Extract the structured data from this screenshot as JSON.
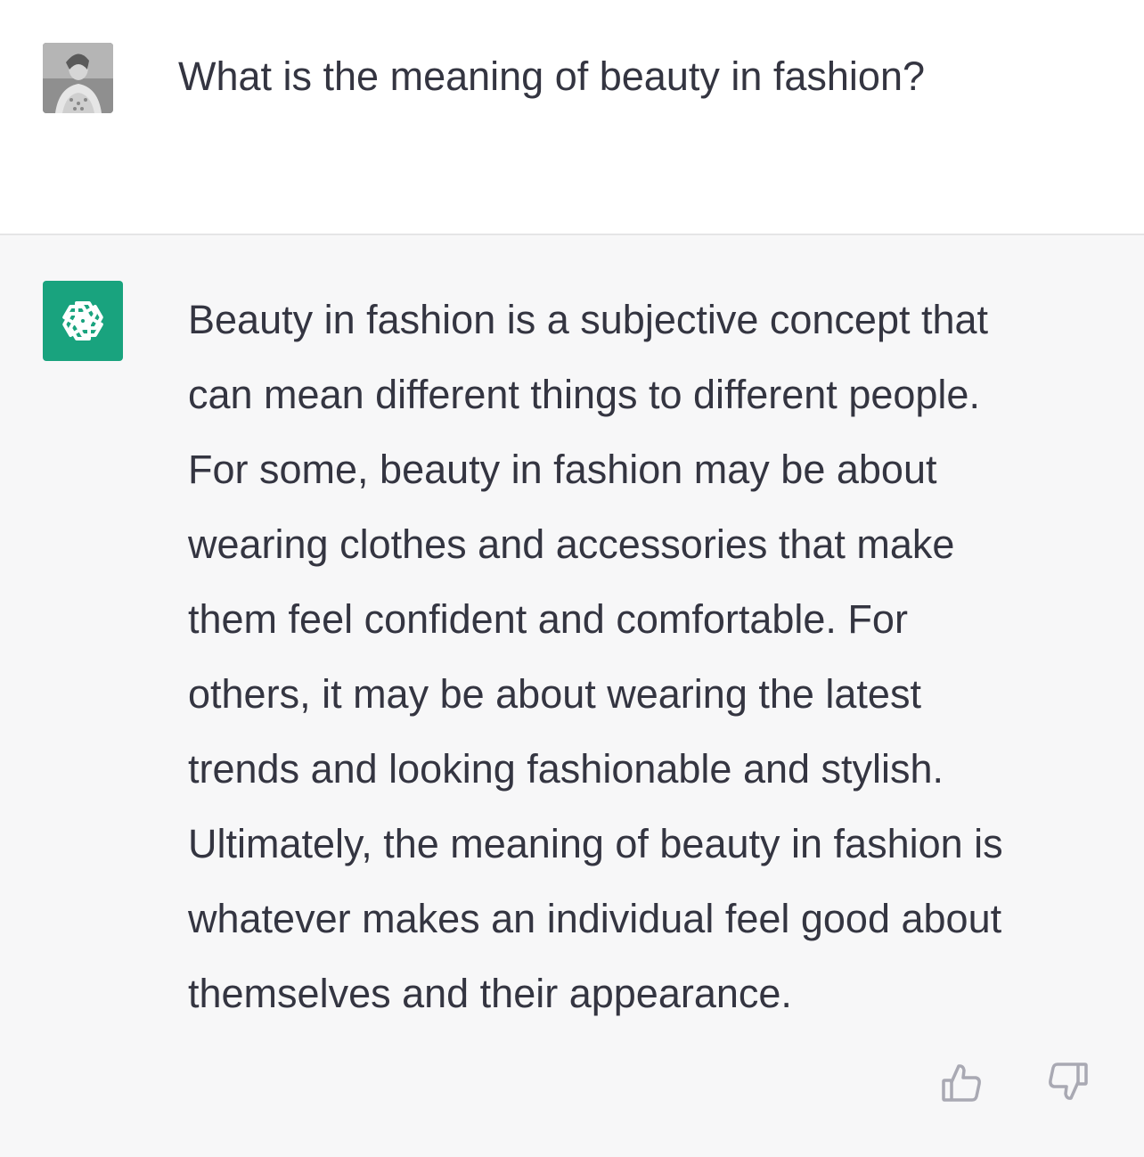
{
  "user_message": {
    "text": "What is the meaning of beauty in fashion?"
  },
  "assistant_message": {
    "lines": [
      "Beauty in fashion is a subjective concept that",
      "can mean different things to different people.",
      "For some, beauty in fashion may be about",
      "wearing clothes and accessories that make",
      "them feel confident and comfortable. For",
      "others, it may be about wearing the latest",
      "trends and looking fashionable and stylish.",
      "Ultimately, the meaning of beauty in fashion is",
      "whatever makes an individual feel good about",
      "themselves and their appearance."
    ]
  },
  "icons": {
    "user_avatar": "user-avatar-photo",
    "assistant_avatar": "openai-logo-icon",
    "thumbs_up": "thumbs-up-icon",
    "thumbs_down": "thumbs-down-icon"
  },
  "colors": {
    "assistant_avatar_bg": "#19a37e",
    "assistant_turn_bg": "#f7f7f8",
    "text": "#343541",
    "feedback_icon": "#a9a9b3"
  }
}
